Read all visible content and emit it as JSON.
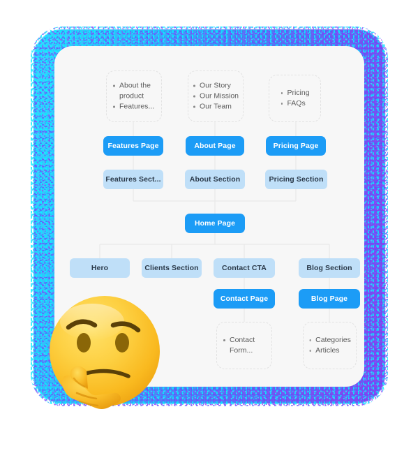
{
  "card": {
    "background_color": "#f7f7f7",
    "glow_start_color": "#3ad7ff",
    "glow_mid_color": "#4f7bf4",
    "glow_end_color": "#8144ef"
  },
  "theme": {
    "page_node_color": "#1c9cf6",
    "page_node_text_color": "#ffffff",
    "section_node_color": "#bfdff8",
    "section_node_text_color": "#2b3a4a",
    "list_border_color": "#e2e2e2",
    "list_text_color": "#5b5b5b",
    "connector_color": "#e6e6e6"
  },
  "sitemap": {
    "root": {
      "label": "Home Page",
      "type": "page"
    },
    "pages": [
      {
        "label": "Features Page",
        "type": "page"
      },
      {
        "label": "About Page",
        "type": "page"
      },
      {
        "label": "Pricing Page",
        "type": "page"
      },
      {
        "label": "Contact Page",
        "type": "page"
      },
      {
        "label": "Blog Page",
        "type": "page"
      }
    ],
    "sections": [
      {
        "label": "Features Sect...",
        "type": "section"
      },
      {
        "label": "About Section",
        "type": "section"
      },
      {
        "label": "Pricing Section",
        "type": "section"
      },
      {
        "label": "Hero",
        "type": "section"
      },
      {
        "label": "Clients Section",
        "type": "section"
      },
      {
        "label": "Contact CTA",
        "type": "section"
      },
      {
        "label": "Blog Section",
        "type": "section"
      }
    ],
    "lists": [
      {
        "items": [
          "About the product",
          "Features..."
        ]
      },
      {
        "items": [
          "Our Story",
          "Our Mission",
          "Our Team"
        ]
      },
      {
        "items": [
          "Pricing",
          "FAQs"
        ]
      },
      {
        "items": [
          "Contact Form..."
        ]
      },
      {
        "items": [
          "Categories",
          "Articles"
        ]
      }
    ]
  },
  "emoji": {
    "name": "thinking-face",
    "glyph": "🤔"
  }
}
